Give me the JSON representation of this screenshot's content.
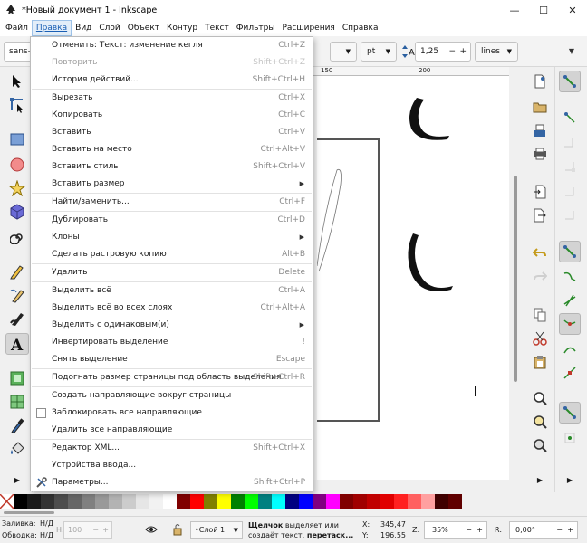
{
  "window": {
    "title": "*Новый документ 1 - Inkscape",
    "controls": {
      "minimize": "—",
      "maximize": "☐",
      "close": "✕"
    }
  },
  "menubar": {
    "items": [
      "Файл",
      "Правка",
      "Вид",
      "Слой",
      "Объект",
      "Контур",
      "Текст",
      "Фильтры",
      "Расширения",
      "Справка"
    ],
    "active": "Правка"
  },
  "toolbar": {
    "font_family": "sans-s",
    "unit": "pt",
    "spacing_value": "1,25",
    "spacing_mode": "lines",
    "minus": "−",
    "plus": "+"
  },
  "ruler": {
    "tick_150": "150",
    "tick_200": "200"
  },
  "edit_menu": {
    "items": [
      {
        "label": "Отменить: Текст: изменение кегля",
        "shortcut": "Ctrl+Z",
        "disabled": false
      },
      {
        "label": "Повторить",
        "shortcut": "Shift+Ctrl+Z",
        "disabled": true
      },
      {
        "label": "История действий...",
        "shortcut": "Shift+Ctrl+H",
        "disabled": false
      },
      {
        "label": "Вырезать",
        "shortcut": "Ctrl+X",
        "disabled": false
      },
      {
        "label": "Копировать",
        "shortcut": "Ctrl+C",
        "disabled": false
      },
      {
        "label": "Вставить",
        "shortcut": "Ctrl+V",
        "disabled": false
      },
      {
        "label": "Вставить на место",
        "shortcut": "Ctrl+Alt+V",
        "disabled": false
      },
      {
        "label": "Вставить стиль",
        "shortcut": "Shift+Ctrl+V",
        "disabled": false
      },
      {
        "label": "Вставить размер",
        "shortcut": "▶",
        "disabled": false
      },
      {
        "label": "Найти/заменить...",
        "shortcut": "Ctrl+F",
        "disabled": false
      },
      {
        "label": "Дублировать",
        "shortcut": "Ctrl+D",
        "disabled": false
      },
      {
        "label": "Клоны",
        "shortcut": "▶",
        "disabled": false
      },
      {
        "label": "Сделать растровую копию",
        "shortcut": "Alt+B",
        "disabled": false
      },
      {
        "label": "Удалить",
        "shortcut": "Delete",
        "disabled": false
      },
      {
        "label": "Выделить всё",
        "shortcut": "Ctrl+A",
        "disabled": false
      },
      {
        "label": "Выделить всё во всех слоях",
        "shortcut": "Ctrl+Alt+A",
        "disabled": false
      },
      {
        "label": "Выделить с одинаковым(и)",
        "shortcut": "▶",
        "disabled": false
      },
      {
        "label": "Инвертировать выделение",
        "shortcut": "!",
        "disabled": false
      },
      {
        "label": "Снять выделение",
        "shortcut": "Escape",
        "disabled": false
      },
      {
        "label": "Подогнать размер страницы под область выделения",
        "shortcut": "Shift+Ctrl+R",
        "disabled": false
      },
      {
        "label": "Создать направляющие вокруг страницы",
        "shortcut": "",
        "disabled": false
      },
      {
        "label": "Заблокировать все направляющие",
        "shortcut": "",
        "disabled": false
      },
      {
        "label": "Удалить все направляющие",
        "shortcut": "",
        "disabled": false
      },
      {
        "label": "Редактор XML...",
        "shortcut": "Shift+Ctrl+X",
        "disabled": false
      },
      {
        "label": "Устройства ввода...",
        "shortcut": "",
        "disabled": false
      },
      {
        "label": "Параметры...",
        "shortcut": "Shift+Ctrl+P",
        "disabled": false
      }
    ]
  },
  "statusbar": {
    "fill_label": "Заливка:",
    "fill_value": "Н/Д",
    "stroke_label": "Обводка:",
    "stroke_value": "Н/Д",
    "h_label": "H:",
    "h_value": "100",
    "layer": "•Слой 1",
    "message_bold": "Щелчок",
    "message_rest": " выделяет или",
    "message_line2": "создаёт текст,",
    "message_bold2": " перетаск...",
    "x_label": "X:",
    "x_value": "345,47",
    "y_label": "Y:",
    "y_value": "196,55",
    "z_label": "Z:",
    "zoom": "35%",
    "r_label": "R:",
    "rotation": "0,00°"
  },
  "palette": {
    "colors": [
      "#000000",
      "#1a1a1a",
      "#333333",
      "#4d4d4d",
      "#666666",
      "#808080",
      "#999999",
      "#b3b3b3",
      "#cccccc",
      "#e6e6e6",
      "#f2f2f2",
      "#ffffff",
      "#800000",
      "#ff0000",
      "#808000",
      "#ffff00",
      "#008000",
      "#00ff00",
      "#008080",
      "#00ffff",
      "#000080",
      "#0000ff",
      "#800080",
      "#ff00ff",
      "#800000",
      "#a00000",
      "#c00000",
      "#e00000",
      "#ff2020",
      "#ff6060",
      "#ffa0a0",
      "#400000",
      "#600000"
    ]
  },
  "colors": {
    "menu_active_bg": "#e3eef9",
    "accent": "#1a5fb4"
  }
}
